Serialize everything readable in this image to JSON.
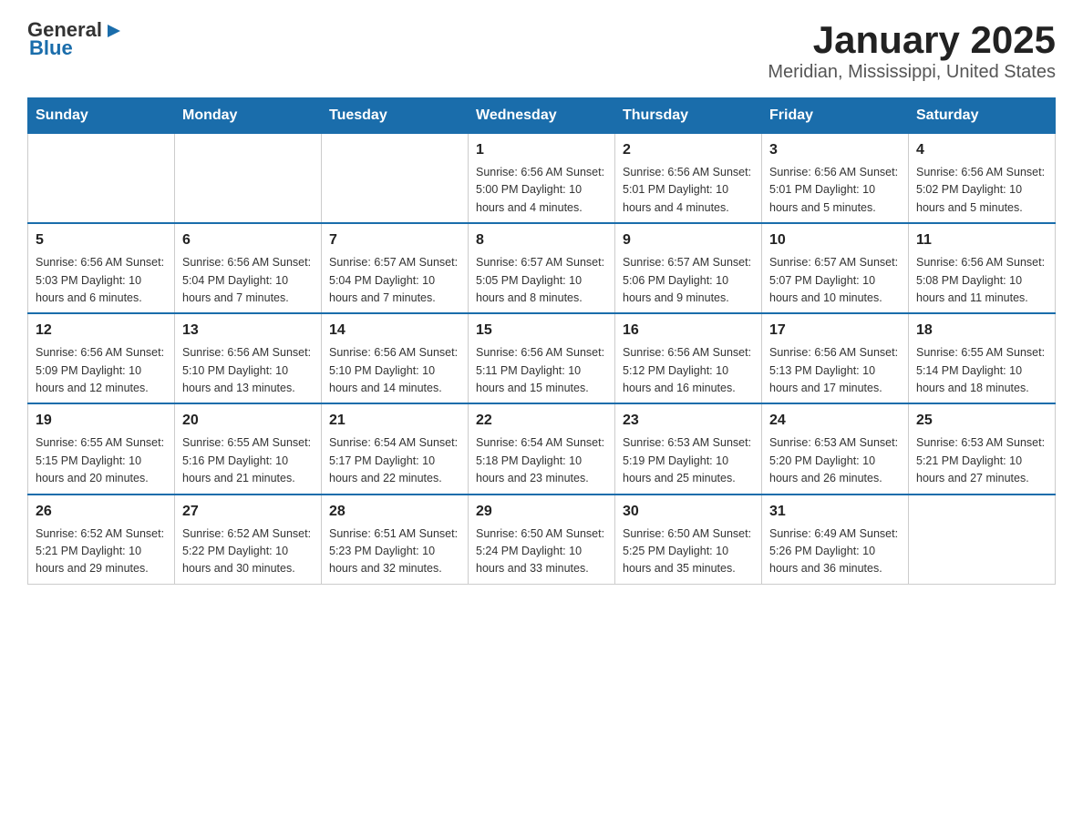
{
  "header": {
    "logo_general": "General",
    "logo_blue": "Blue",
    "title": "January 2025",
    "subtitle": "Meridian, Mississippi, United States"
  },
  "days_of_week": [
    "Sunday",
    "Monday",
    "Tuesday",
    "Wednesday",
    "Thursday",
    "Friday",
    "Saturday"
  ],
  "weeks": [
    [
      {
        "day": "",
        "info": ""
      },
      {
        "day": "",
        "info": ""
      },
      {
        "day": "",
        "info": ""
      },
      {
        "day": "1",
        "info": "Sunrise: 6:56 AM\nSunset: 5:00 PM\nDaylight: 10 hours and 4 minutes."
      },
      {
        "day": "2",
        "info": "Sunrise: 6:56 AM\nSunset: 5:01 PM\nDaylight: 10 hours and 4 minutes."
      },
      {
        "day": "3",
        "info": "Sunrise: 6:56 AM\nSunset: 5:01 PM\nDaylight: 10 hours and 5 minutes."
      },
      {
        "day": "4",
        "info": "Sunrise: 6:56 AM\nSunset: 5:02 PM\nDaylight: 10 hours and 5 minutes."
      }
    ],
    [
      {
        "day": "5",
        "info": "Sunrise: 6:56 AM\nSunset: 5:03 PM\nDaylight: 10 hours and 6 minutes."
      },
      {
        "day": "6",
        "info": "Sunrise: 6:56 AM\nSunset: 5:04 PM\nDaylight: 10 hours and 7 minutes."
      },
      {
        "day": "7",
        "info": "Sunrise: 6:57 AM\nSunset: 5:04 PM\nDaylight: 10 hours and 7 minutes."
      },
      {
        "day": "8",
        "info": "Sunrise: 6:57 AM\nSunset: 5:05 PM\nDaylight: 10 hours and 8 minutes."
      },
      {
        "day": "9",
        "info": "Sunrise: 6:57 AM\nSunset: 5:06 PM\nDaylight: 10 hours and 9 minutes."
      },
      {
        "day": "10",
        "info": "Sunrise: 6:57 AM\nSunset: 5:07 PM\nDaylight: 10 hours and 10 minutes."
      },
      {
        "day": "11",
        "info": "Sunrise: 6:56 AM\nSunset: 5:08 PM\nDaylight: 10 hours and 11 minutes."
      }
    ],
    [
      {
        "day": "12",
        "info": "Sunrise: 6:56 AM\nSunset: 5:09 PM\nDaylight: 10 hours and 12 minutes."
      },
      {
        "day": "13",
        "info": "Sunrise: 6:56 AM\nSunset: 5:10 PM\nDaylight: 10 hours and 13 minutes."
      },
      {
        "day": "14",
        "info": "Sunrise: 6:56 AM\nSunset: 5:10 PM\nDaylight: 10 hours and 14 minutes."
      },
      {
        "day": "15",
        "info": "Sunrise: 6:56 AM\nSunset: 5:11 PM\nDaylight: 10 hours and 15 minutes."
      },
      {
        "day": "16",
        "info": "Sunrise: 6:56 AM\nSunset: 5:12 PM\nDaylight: 10 hours and 16 minutes."
      },
      {
        "day": "17",
        "info": "Sunrise: 6:56 AM\nSunset: 5:13 PM\nDaylight: 10 hours and 17 minutes."
      },
      {
        "day": "18",
        "info": "Sunrise: 6:55 AM\nSunset: 5:14 PM\nDaylight: 10 hours and 18 minutes."
      }
    ],
    [
      {
        "day": "19",
        "info": "Sunrise: 6:55 AM\nSunset: 5:15 PM\nDaylight: 10 hours and 20 minutes."
      },
      {
        "day": "20",
        "info": "Sunrise: 6:55 AM\nSunset: 5:16 PM\nDaylight: 10 hours and 21 minutes."
      },
      {
        "day": "21",
        "info": "Sunrise: 6:54 AM\nSunset: 5:17 PM\nDaylight: 10 hours and 22 minutes."
      },
      {
        "day": "22",
        "info": "Sunrise: 6:54 AM\nSunset: 5:18 PM\nDaylight: 10 hours and 23 minutes."
      },
      {
        "day": "23",
        "info": "Sunrise: 6:53 AM\nSunset: 5:19 PM\nDaylight: 10 hours and 25 minutes."
      },
      {
        "day": "24",
        "info": "Sunrise: 6:53 AM\nSunset: 5:20 PM\nDaylight: 10 hours and 26 minutes."
      },
      {
        "day": "25",
        "info": "Sunrise: 6:53 AM\nSunset: 5:21 PM\nDaylight: 10 hours and 27 minutes."
      }
    ],
    [
      {
        "day": "26",
        "info": "Sunrise: 6:52 AM\nSunset: 5:21 PM\nDaylight: 10 hours and 29 minutes."
      },
      {
        "day": "27",
        "info": "Sunrise: 6:52 AM\nSunset: 5:22 PM\nDaylight: 10 hours and 30 minutes."
      },
      {
        "day": "28",
        "info": "Sunrise: 6:51 AM\nSunset: 5:23 PM\nDaylight: 10 hours and 32 minutes."
      },
      {
        "day": "29",
        "info": "Sunrise: 6:50 AM\nSunset: 5:24 PM\nDaylight: 10 hours and 33 minutes."
      },
      {
        "day": "30",
        "info": "Sunrise: 6:50 AM\nSunset: 5:25 PM\nDaylight: 10 hours and 35 minutes."
      },
      {
        "day": "31",
        "info": "Sunrise: 6:49 AM\nSunset: 5:26 PM\nDaylight: 10 hours and 36 minutes."
      },
      {
        "day": "",
        "info": ""
      }
    ]
  ]
}
